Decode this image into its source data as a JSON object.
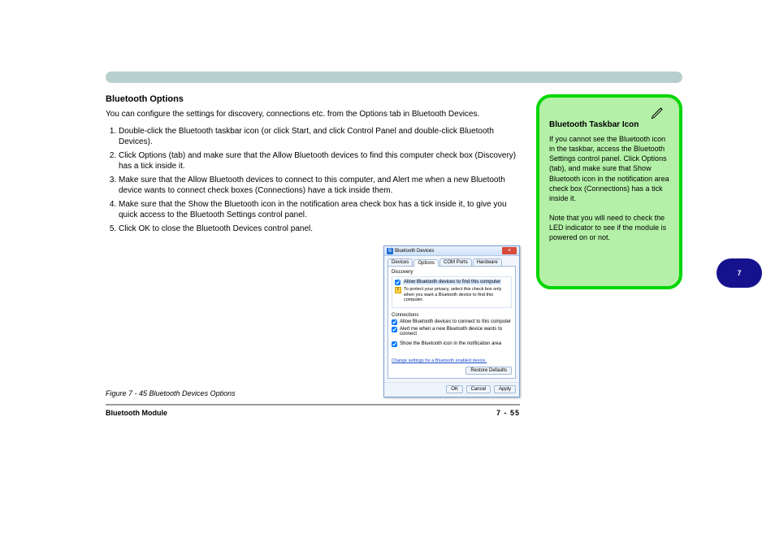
{
  "section": {
    "heading": "Bluetooth Options",
    "intro": "You can configure the settings for discovery, connections etc. from the Options tab in Bluetooth Devices.",
    "steps": [
      "Double-click the Bluetooth taskbar icon (or click Start, and click Control Panel and double-click Bluetooth Devices).",
      "Click Options (tab) and make sure that the Allow Bluetooth devices to find this computer check box (Discovery) has a tick inside it.",
      "Make sure that the Allow Bluetooth devices to connect to this computer, and Alert me when a new Bluetooth device wants to connect check boxes (Connections) have a tick inside them.",
      "Make sure that the Show the Bluetooth icon in the notification area check box has a tick inside it, to give you quick access to the Bluetooth Settings control panel.",
      "Click OK to close the Bluetooth Devices control panel."
    ],
    "figure_caption": "Figure 7 - 45 Bluetooth Devices Options"
  },
  "dialog": {
    "title": "Bluetooth Devices",
    "tabs": [
      "Devices",
      "Options",
      "COM Ports",
      "Hardware"
    ],
    "active_tab": "Options",
    "discovery": {
      "group": "Discovery",
      "checkbox": "Allow Bluetooth devices to find this computer",
      "warning": "To protect your privacy, select this check box only when you want a Bluetooth device to find this computer."
    },
    "connections": {
      "group": "Connections",
      "checkbox1": "Allow Bluetooth devices to connect to this computer",
      "checkbox2": "Alert me when a new Bluetooth device wants to connect"
    },
    "notify_checkbox": "Show the Bluetooth icon in the notification area",
    "link": "Change settings for a Bluetooth enabled device.",
    "restore": "Restore Defaults",
    "ok": "OK",
    "cancel": "Cancel",
    "apply": "Apply"
  },
  "note": {
    "title": "Bluetooth Taskbar Icon",
    "body": "If you cannot see the Bluetooth icon in the taskbar, access the Bluetooth Settings control panel. Click Options (tab), and make sure that Show Bluetooth icon in the notification area check box (Connections) has a tick inside it.\n\nNote that you will need to check the LED indicator to see if the module is powered on or not."
  },
  "sidetab": "7",
  "footer": {
    "left": "Bluetooth Module",
    "page": "7 - 55"
  }
}
